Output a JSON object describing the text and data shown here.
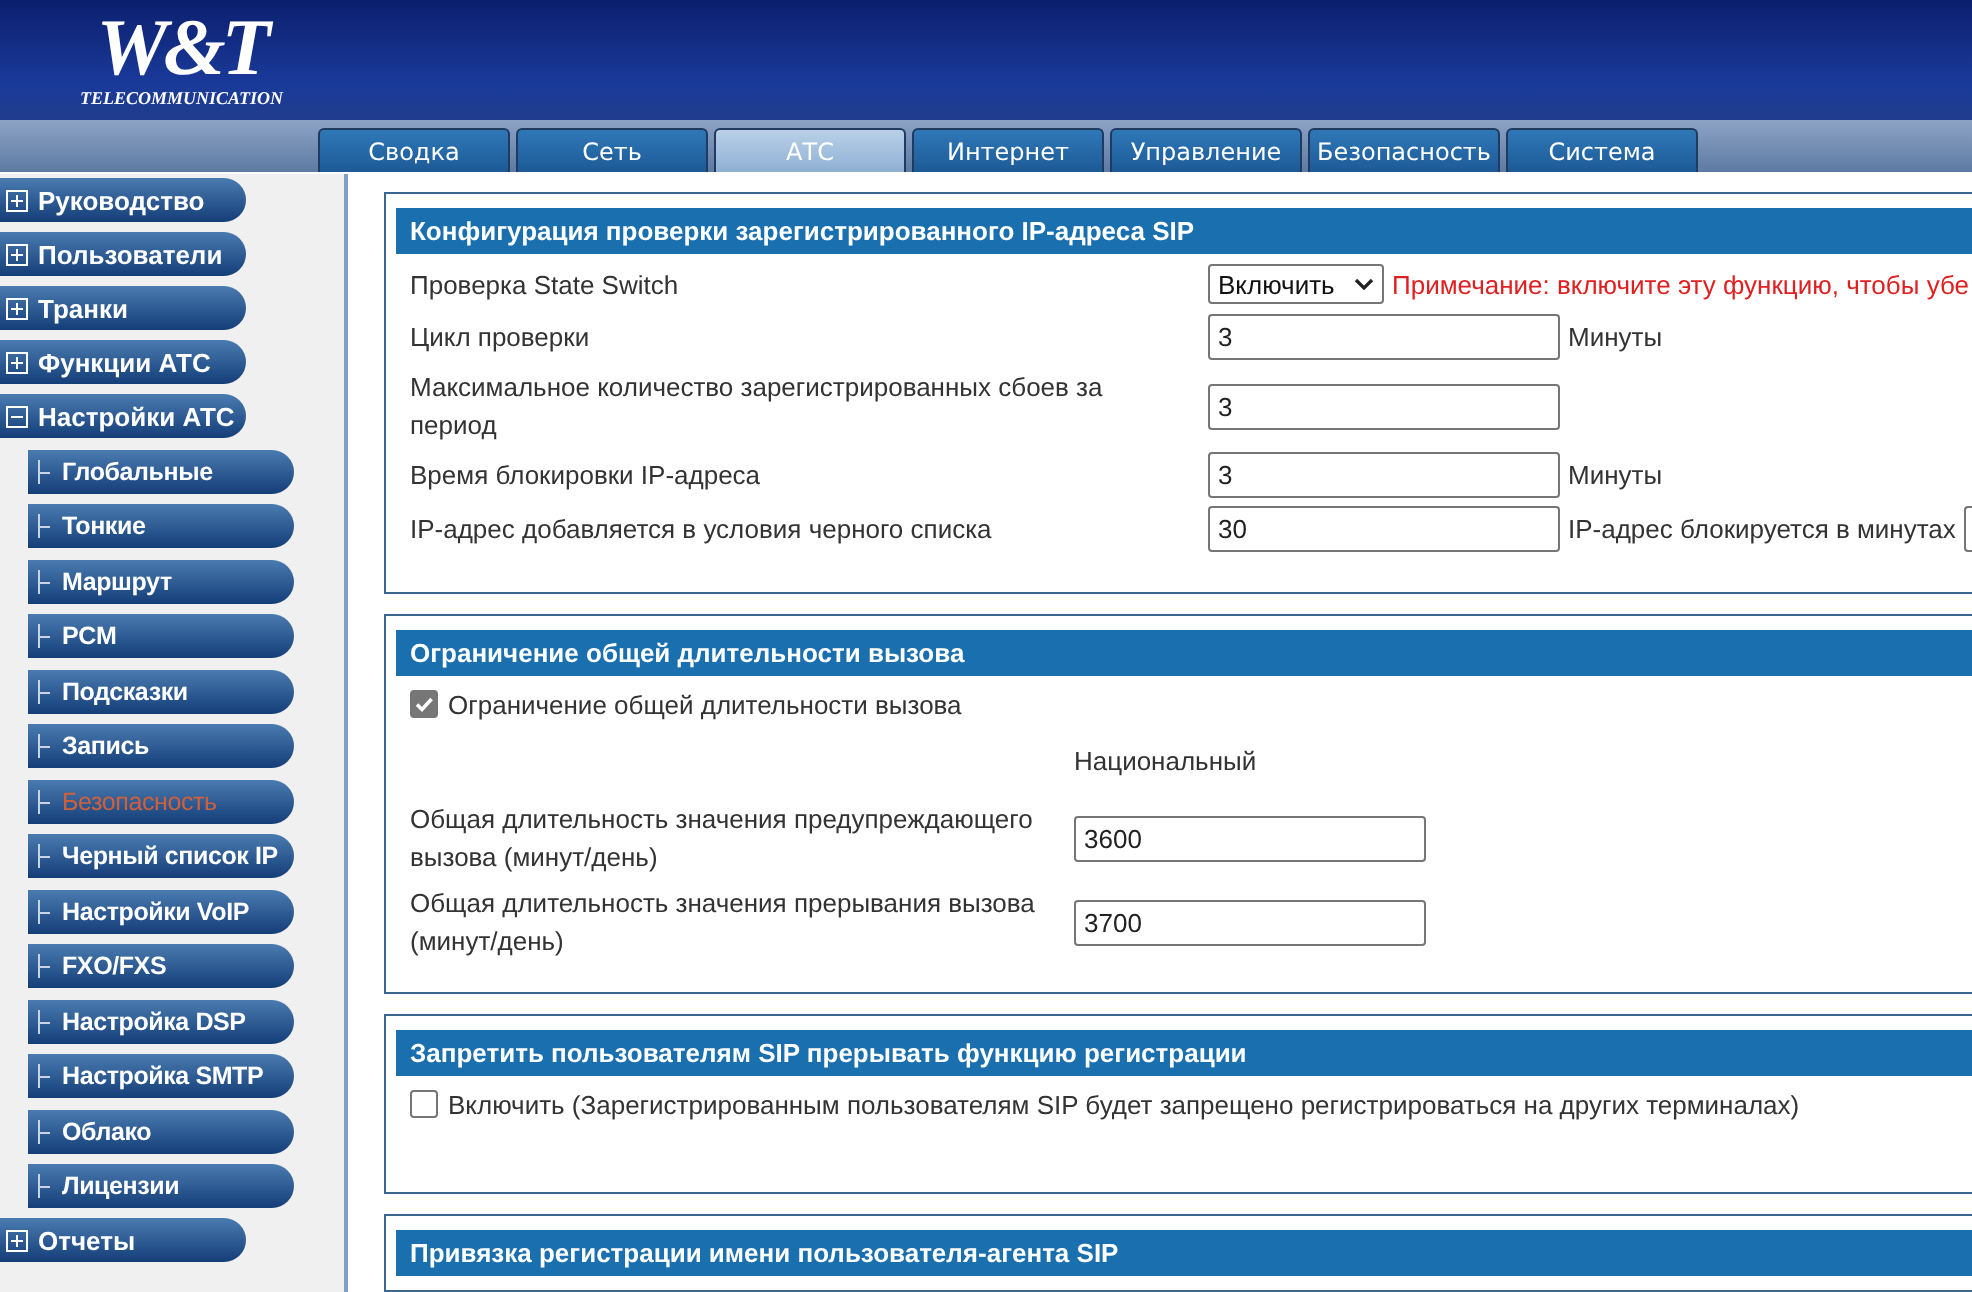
{
  "header": {
    "logo": "W&T",
    "logo_subtitle": "TELECOMMUNICATION"
  },
  "tabs": [
    {
      "label": "Сводка",
      "selected": false
    },
    {
      "label": "Сеть",
      "selected": false
    },
    {
      "label": "АТС",
      "selected": true
    },
    {
      "label": "Интернет",
      "selected": false
    },
    {
      "label": "Управление",
      "selected": false
    },
    {
      "label": "Безопасность",
      "selected": false
    },
    {
      "label": "Система",
      "selected": false
    }
  ],
  "sidebar": {
    "items": [
      {
        "label": "Руководство",
        "expanded": false
      },
      {
        "label": "Пользователи",
        "expanded": false
      },
      {
        "label": "Транки",
        "expanded": false
      },
      {
        "label": "Функции АТС",
        "expanded": false
      },
      {
        "label": "Настройки АТС",
        "expanded": true,
        "children": [
          {
            "label": "Глобальные",
            "selected": false
          },
          {
            "label": "Тонкие",
            "selected": false
          },
          {
            "label": "Маршрут",
            "selected": false
          },
          {
            "label": "PCM",
            "selected": false
          },
          {
            "label": "Подсказки",
            "selected": false
          },
          {
            "label": "Запись",
            "selected": false
          },
          {
            "label": "Безопасность",
            "selected": true
          },
          {
            "label": "Черный список IP",
            "selected": false
          },
          {
            "label": "Настройки VoIP",
            "selected": false
          },
          {
            "label": "FXO/FXS",
            "selected": false
          },
          {
            "label": "Настройка DSP",
            "selected": false
          },
          {
            "label": "Настройка SMTP",
            "selected": false
          },
          {
            "label": "Облако",
            "selected": false
          },
          {
            "label": "Лицензии",
            "selected": false
          }
        ]
      },
      {
        "label": "Отчеты",
        "expanded": false
      }
    ]
  },
  "sections": [
    {
      "kind": "form",
      "title": "Конфигурация проверки зарегистрированного IP-адреса SIP",
      "rows": [
        {
          "kind": "select",
          "label": "Проверка State Switch",
          "value": "Включить",
          "note": "Примечание: включите эту функцию, чтобы убе"
        },
        {
          "kind": "input",
          "label": "Цикл проверки",
          "value": "3",
          "unit": "Минуты"
        },
        {
          "kind": "input",
          "label": "Максимальное количество зарегистрированных сбоев за период",
          "value": "3"
        },
        {
          "kind": "input",
          "label": "Время блокировки IP-адреса",
          "value": "3",
          "unit": "Минуты"
        },
        {
          "kind": "input_pair",
          "label": "IP-адрес добавляется в условия черного списка",
          "value": "30",
          "unit": "IP-адрес блокируется в минутах"
        }
      ]
    },
    {
      "kind": "limit",
      "title": "Ограничение общей длительности вызова",
      "checkbox": {
        "label": "Ограничение общей длительности вызова",
        "checked": true
      },
      "column_heading": "Национальный",
      "rows": [
        {
          "label": "Общая длительность значения предупреждающего вызова (минут/день)",
          "value": "3600"
        },
        {
          "label": "Общая длительность значения прерывания вызова (минут/день)",
          "value": "3700"
        }
      ]
    },
    {
      "kind": "checkbox",
      "title": "Запретить пользователям SIP прерывать функцию регистрации",
      "checkbox": {
        "label": "Включить (Зарегистрированным пользователям SIP будет запрещено регистрироваться на других терминалах)",
        "checked": false
      }
    },
    {
      "kind": "title_only",
      "title": "Привязка регистрации имени пользователя-агента SIP"
    }
  ]
}
